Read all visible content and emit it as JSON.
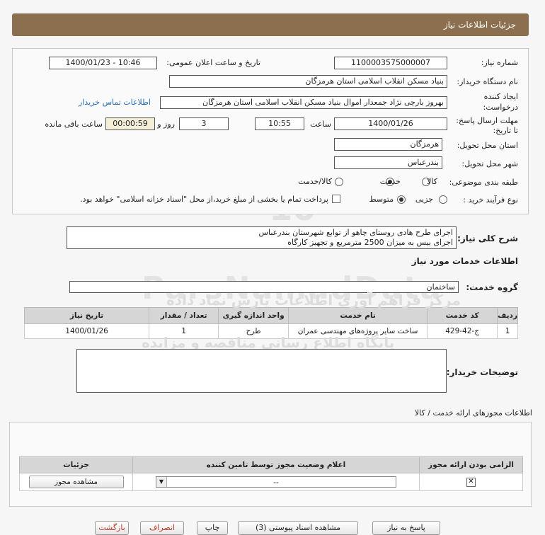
{
  "header": {
    "title": "جزئیات اطلاعات نیاز"
  },
  "fields": {
    "need_number_label": "شماره نیاز:",
    "need_number": "1100003575000007",
    "announce_label": "تاریخ و ساعت اعلان عمومی:",
    "announce_value": "1400/01/23 - 10:46",
    "buyer_org_label": "نام دستگاه خریدار:",
    "buyer_org": "بنیاد مسکن انقلاب اسلامی استان هرمزگان",
    "creator_label_1": "ایجاد کننده",
    "creator_label_2": "درخواست:",
    "creator": "بهروز  بارچی نژاد جمعدار اموال بنیاد مسکن انقلاب اسلامی استان هرمزگان",
    "contact_link": "اطلاعات تماس خریدار",
    "deadline_label_1": "مهلت ارسال پاسخ:",
    "deadline_label_2": "تا تاریخ:",
    "deadline_date": "1400/01/26",
    "time_label": "ساعت",
    "deadline_time": "10:55",
    "days": "3",
    "days_label": "روز و",
    "remaining": "00:00:59",
    "remaining_label": "ساعت باقی مانده",
    "province_label": "استان محل تحویل:",
    "province": "هرمزگان",
    "city_label": "شهر محل تحویل:",
    "city": "بندرعباس",
    "category_label": "طبقه بندی موضوعی:",
    "category_options": [
      "کالا",
      "خدمت",
      "کالا/خدمت"
    ],
    "category_selected": "خدمت",
    "process_label": "نوع فرآیند خرید :",
    "process_options": [
      "جزیی",
      "متوسط"
    ],
    "process_selected": "متوسط",
    "payment_text": "پرداخت تمام یا بخشی از مبلغ خرید،از محل \"اسناد خزانه اسلامی\" خواهد بود."
  },
  "description": {
    "label": "شرح کلی نیاز:",
    "line1": "اجرای  طرح هادی روستای  چاهو از توابع شهرستان بندرعباس",
    "line2": "اجرای بیس به میزان 2500  مترمربع و تجهیز کارگاه"
  },
  "services": {
    "section_title": "اطلاعات خدمات مورد نیاز",
    "group_label": "گروه خدمت:",
    "group_value": "ساختمان",
    "columns": [
      "ردیف",
      "کد خدمت",
      "نام خدمت",
      "واحد اندازه گیری",
      "تعداد / مقدار",
      "تاریخ نیاز"
    ],
    "rows": [
      [
        "1",
        "ج-42-429",
        "ساخت سایر پروژه‌های مهندسی عمران",
        "طرح",
        "1",
        "1400/01/26"
      ]
    ]
  },
  "buyer_notes": {
    "label": "توضیحات خریدار:",
    "value": ""
  },
  "permits": {
    "section_title": "اطلاعات مجوزهای ارائه خدمت / کالا",
    "columns": [
      "الزامی بودن ارائه مجوز",
      "اعلام وضعیت مجوز توسط تامین کننده",
      "جزئیات"
    ],
    "select_value": "--",
    "view_button": "مشاهده مجوز"
  },
  "watermark": {
    "line1": "ParsNamadData",
    "line2": "مرکز فراهم آوری اطلاعات پارس نماد داده",
    "line3": "پایگاه اطلاع رسانی مناقصه و مزایده",
    "phone": "۰۲۱-۸۸۳۴۹۶۷۰-۵"
  },
  "bottom_buttons": [
    "بازگشت",
    "انصراف",
    "چاپ",
    "مشاهده اسناد پیوستی (3)",
    "پاسخ به نیاز",
    "..."
  ]
}
